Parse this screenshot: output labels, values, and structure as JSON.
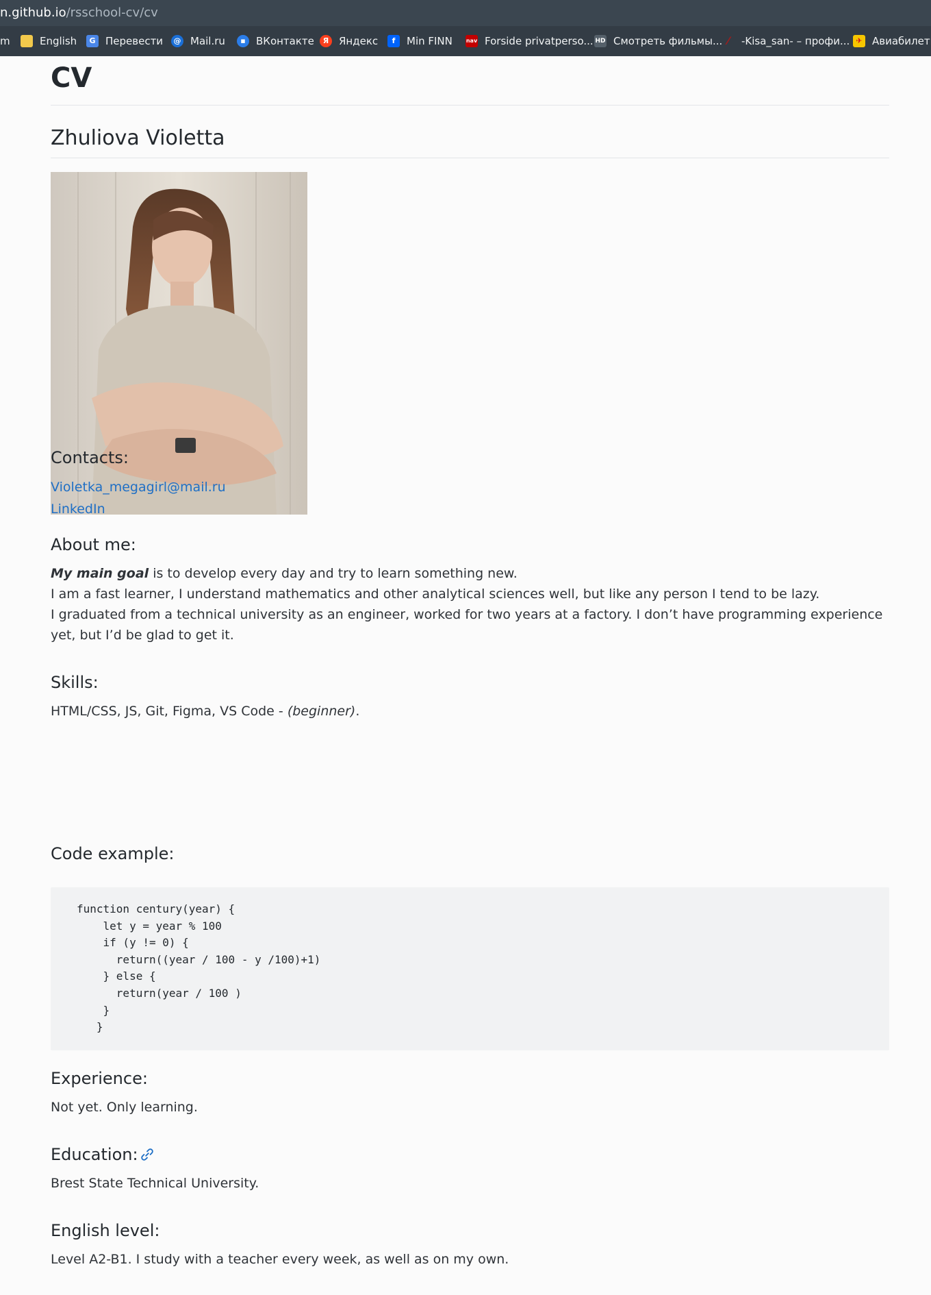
{
  "browser": {
    "url_host": "n.github.io",
    "url_path": "/rsschool-cv/cv",
    "bookmarks": [
      {
        "label": "m",
        "icon": "none"
      },
      {
        "label": "English",
        "icon": "folder-icon"
      },
      {
        "label": "Перевести",
        "icon": "translate-icon"
      },
      {
        "label": "Mail.ru",
        "icon": "mailru-icon"
      },
      {
        "label": "ВКонтакте",
        "icon": "chat-icon"
      },
      {
        "label": "Яндекс",
        "icon": "yandex-icon"
      },
      {
        "label": "Min FINN",
        "icon": "finn-icon"
      },
      {
        "label": "Forside privatperso...",
        "icon": "nav-icon"
      },
      {
        "label": "Смотреть фильмы...",
        "icon": "hd-icon"
      },
      {
        "label": "-Kisa_san- – профи...",
        "icon": "feather-icon"
      },
      {
        "label": "Авиабилеты",
        "icon": "tickets-icon"
      }
    ],
    "colors": {
      "urlbar": "#3b4650",
      "bookmarks_bar": "#333c45"
    }
  },
  "page": {
    "title": "CV",
    "name": "Zhuliova Violetta",
    "photo_alt": "Portrait photo",
    "contacts": {
      "heading": "Contacts:",
      "email": "Violetka_megagirl@mail.ru",
      "linkedin": "LinkedIn"
    },
    "about": {
      "heading": "About me:",
      "goal_label": "My main goal",
      "goal_text": " is to develop every day and try to learn something new.",
      "line2": "I am a fast learner, I understand mathematics and other analytical sciences well, but like any person I tend to be lazy.",
      "line3": "I graduated from a technical university as an engineer, worked for two years at a factory. I don’t have programming experience yet, but I’d be glad to get it."
    },
    "skills": {
      "heading": "Skills:",
      "list": "HTML/CSS, JS, Git, Figma, VS Code - ",
      "level": "(beginner)",
      "end": "."
    },
    "code": {
      "heading": "Code example:",
      "snippet": "function century(year) {\n    let y = year % 100\n    if (y != 0) {\n      return((year / 100 - y /100)+1)\n    } else {\n      return(year / 100 )\n    }\n   }"
    },
    "experience": {
      "heading": "Experience:",
      "text": "Not yet. Only learning."
    },
    "education": {
      "heading": "Education:",
      "text": "Brest State Technical University."
    },
    "english": {
      "heading": "English level:",
      "text": "Level A2-B1. I study with a teacher every week, as well as on my own."
    },
    "colors": {
      "link": "#1f6fc5",
      "text": "#24292e",
      "code_bg": "#f1f2f3"
    }
  }
}
